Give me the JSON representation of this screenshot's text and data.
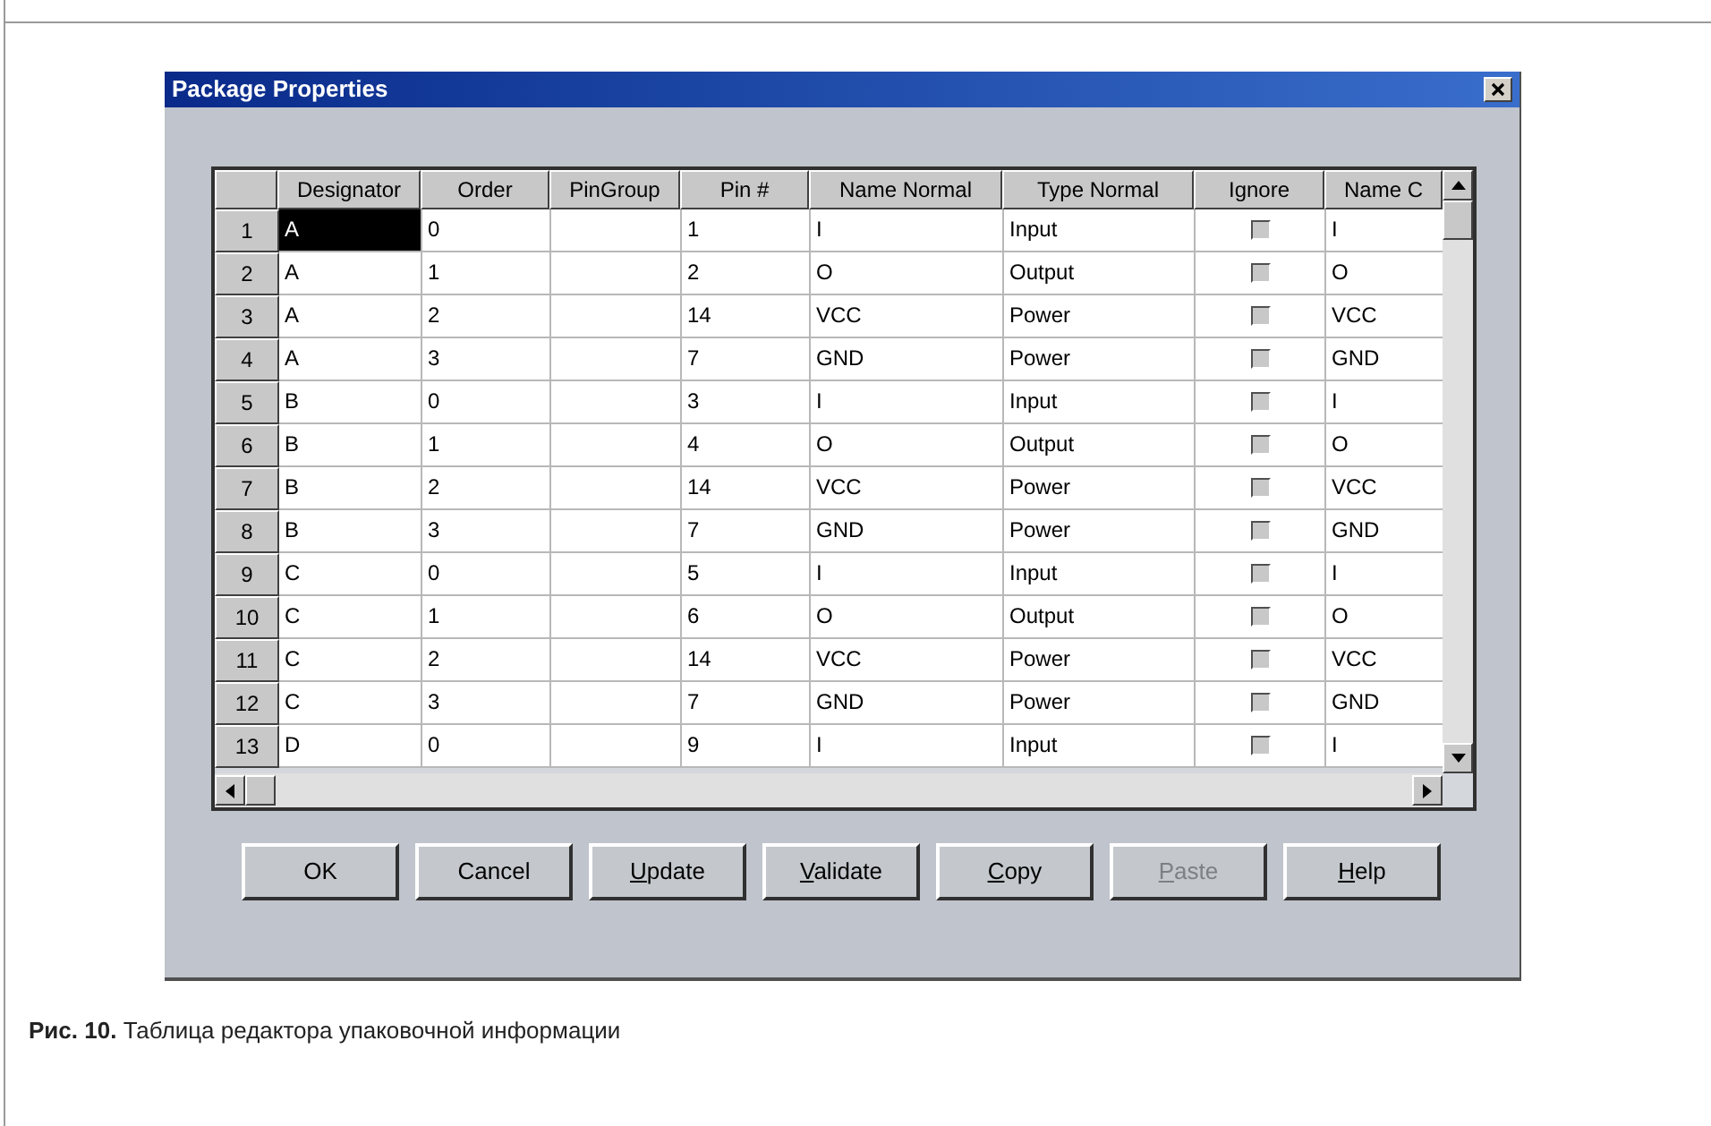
{
  "window": {
    "title": "Package Properties"
  },
  "table": {
    "columns": [
      "Designator",
      "Order",
      "PinGroup",
      "Pin #",
      "Name Normal",
      "Type Normal",
      "Ignore",
      "Name C"
    ],
    "rows": [
      {
        "number": "1",
        "designator": "A",
        "designator_selected": true,
        "order": "0",
        "pin": "1",
        "name_normal": "I",
        "type_normal": "Input",
        "ignore_checked": false,
        "name_c": "I"
      },
      {
        "number": "2",
        "designator": "A",
        "designator_selected": false,
        "order": "1",
        "pin": "2",
        "name_normal": "O",
        "type_normal": "Output",
        "ignore_checked": false,
        "name_c": "O"
      },
      {
        "number": "3",
        "designator": "A",
        "designator_selected": false,
        "order": "2",
        "pin": "14",
        "name_normal": "VCC",
        "type_normal": "Power",
        "ignore_checked": false,
        "name_c": "VCC"
      },
      {
        "number": "4",
        "designator": "A",
        "designator_selected": false,
        "order": "3",
        "pin": "7",
        "name_normal": "GND",
        "type_normal": "Power",
        "ignore_checked": false,
        "name_c": "GND"
      },
      {
        "number": "5",
        "designator": "B",
        "designator_selected": false,
        "order": "0",
        "pin": "3",
        "name_normal": "I",
        "type_normal": "Input",
        "ignore_checked": false,
        "name_c": "I"
      },
      {
        "number": "6",
        "designator": "B",
        "designator_selected": false,
        "order": "1",
        "pin": "4",
        "name_normal": "O",
        "type_normal": "Output",
        "ignore_checked": false,
        "name_c": "O"
      },
      {
        "number": "7",
        "designator": "B",
        "designator_selected": false,
        "order": "2",
        "pin": "14",
        "name_normal": "VCC",
        "type_normal": "Power",
        "ignore_checked": false,
        "name_c": "VCC"
      },
      {
        "number": "8",
        "designator": "B",
        "designator_selected": false,
        "order": "3",
        "pin": "7",
        "name_normal": "GND",
        "type_normal": "Power",
        "ignore_checked": false,
        "name_c": "GND"
      },
      {
        "number": "9",
        "designator": "C",
        "designator_selected": false,
        "order": "0",
        "pin": "5",
        "name_normal": "I",
        "type_normal": "Input",
        "ignore_checked": false,
        "name_c": "I"
      },
      {
        "number": "10",
        "designator": "C",
        "designator_selected": false,
        "order": "1",
        "pin": "6",
        "name_normal": "O",
        "type_normal": "Output",
        "ignore_checked": false,
        "name_c": "O"
      },
      {
        "number": "11",
        "designator": "C",
        "designator_selected": false,
        "order": "2",
        "pin": "14",
        "name_normal": "VCC",
        "type_normal": "Power",
        "ignore_checked": false,
        "name_c": "VCC"
      },
      {
        "number": "12",
        "designator": "C",
        "designator_selected": false,
        "order": "3",
        "pin": "7",
        "name_normal": "GND",
        "type_normal": "Power",
        "ignore_checked": false,
        "name_c": "GND"
      },
      {
        "number": "13",
        "designator": "D",
        "designator_selected": false,
        "order": "0",
        "pin": "9",
        "name_normal": "I",
        "type_normal": "Input",
        "ignore_checked": false,
        "name_c": "I"
      }
    ]
  },
  "buttons": [
    {
      "label": "OK",
      "mnemonic": false,
      "disabled": false
    },
    {
      "label": "Cancel",
      "mnemonic": false,
      "disabled": false
    },
    {
      "label": "Update",
      "mnemonic": true,
      "disabled": false
    },
    {
      "label": "Validate",
      "mnemonic": true,
      "disabled": false
    },
    {
      "label": "Copy",
      "mnemonic": true,
      "disabled": false
    },
    {
      "label": "Paste",
      "mnemonic": true,
      "disabled": true
    },
    {
      "label": "Help",
      "mnemonic": true,
      "disabled": false
    }
  ],
  "caption": "**Рис. 10.** Таблица редактора упаковочной информации"
}
